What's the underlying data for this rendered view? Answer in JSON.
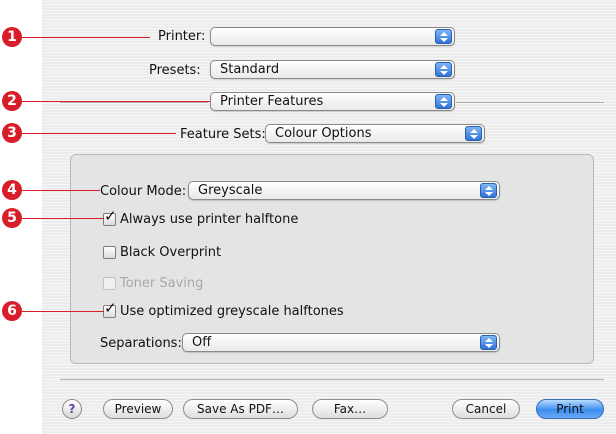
{
  "printer": {
    "label": "Printer:",
    "value": ""
  },
  "presets": {
    "label": "Presets:",
    "value": "Standard"
  },
  "pane_selector": {
    "value": "Printer Features"
  },
  "feature_sets": {
    "label": "Feature Sets:",
    "value": "Colour Options"
  },
  "colour_mode": {
    "label": "Colour Mode:",
    "value": "Greyscale"
  },
  "options": {
    "always_halftone": {
      "label": "Always use printer halftone",
      "checked": true
    },
    "black_overprint": {
      "label": "Black Overprint",
      "checked": false
    },
    "toner_saving": {
      "label": "Toner Saving",
      "checked": false,
      "disabled": true
    },
    "optimized_grey": {
      "label": "Use optimized greyscale halftones",
      "checked": true
    }
  },
  "separations": {
    "label": "Separations:",
    "value": "Off"
  },
  "buttons": {
    "help": "?",
    "preview": "Preview",
    "save_pdf": "Save As PDF…",
    "fax": "Fax…",
    "cancel": "Cancel",
    "print": "Print"
  },
  "callouts": [
    "1",
    "2",
    "3",
    "4",
    "5",
    "6"
  ],
  "colors": {
    "callout": "#d81e2a",
    "accent": "#3d8ef0"
  }
}
